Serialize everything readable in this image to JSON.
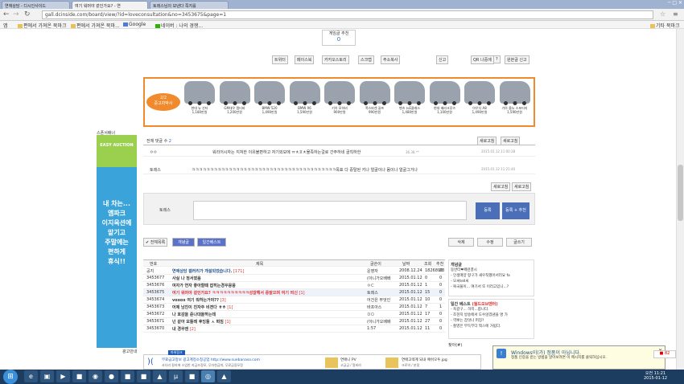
{
  "browser": {
    "tabs": [
      "연애상담 - 디시인사이드",
      "여기 워머야 겉인가요? - 연",
      "토레스님의 보낸다 쪽지를"
    ],
    "url": "gall.dcinside.com/board/view/?id=loveconsultation&no=3453675&page=1"
  },
  "bookmarks": [
    "앱",
    "편에서 가져온 북마크",
    "편에서 가져온 북마...",
    "Google",
    "네이버 : 나의 경쟁...",
    "기타 북마크"
  ],
  "vote": {
    "label": "게임글 추천",
    "count": "0"
  },
  "share": [
    "트위터",
    "페이스북",
    "카카오스토리",
    "스크랩",
    "주소복사"
  ],
  "report": {
    "btn1": "신고",
    "btn2": "QR 나중에",
    "qmark": "?",
    "report": "원본글 신고"
  },
  "ad": {
    "label": "2/2",
    "brand": "중고차박사",
    "cars": [
      {
        "name": "현대 뉴 산타",
        "price": "1,180만원"
      },
      {
        "name": "GM대우 캡티바",
        "price": "1,200만원"
      },
      {
        "name": "BMW 520",
        "price": "1,490만원"
      },
      {
        "name": "BMW X6",
        "price": "1,590만원"
      },
      {
        "name": "기아 모하비",
        "price": "900만원"
      },
      {
        "name": "폭스바겐 골프",
        "price": "990만원"
      },
      {
        "name": "벤츠 뉴E클래스",
        "price": "1,480만원"
      },
      {
        "name": "현대 베라크루즈",
        "price": "1,100만원"
      },
      {
        "name": "아우디 A8",
        "price": "1,490만원"
      },
      {
        "name": "기아 올뉴 스포티지",
        "price": "1,590만원"
      }
    ]
  },
  "comments": {
    "header": "전체 댓글 수",
    "count": "2",
    "controls": [
      "새로고침",
      "새로고침"
    ],
    "items": [
      {
        "name": "ㅇㅇ",
        "text": "워리어시자는 지쳐한 이유불편하고 자기외모에 ㅠㅊㅍㅊ물족하는걸로 간주하네 골칙하한",
        "ip": "36.38.**",
        "date": "2015.01.12 11:00:38"
      },
      {
        "name": "토레스",
        "text": "ㅋㅋㅋㅋㅋㅋㅋㅋㅋㅋㅋㅋㅋㅋㅋㅋㅋㅋㅋㅋㅋㅋㅋㅋㅋㅋㅋㅋㅋㅋㅋㅋㅋㅋㅋㅋㅋㅋㅋ목표 다 중탈된 키나 얼굴이나 몸이나 얼굴그거나",
        "ip": "",
        "date": "2015.01.12 11:21:40"
      }
    ],
    "name_label": "토레스",
    "submit": "등록",
    "submit2": "등록 + 추천"
  },
  "actions": {
    "all": "전체목록",
    "popular": "개념글",
    "best": "일간베스트",
    "delete": "삭제",
    "edit": "수정",
    "write": "글쓰기"
  },
  "list": {
    "headers": [
      "번호",
      "제목",
      "글쓴이",
      "날짜",
      "조회",
      "추천"
    ],
    "rows": [
      {
        "no": "공지",
        "title": "연애상담 갤러리가 개설되었습니다.",
        "cnt": "[171]",
        "writer": "운영자",
        "date": "2008.12.24",
        "views": "1826899",
        "rec": "23"
      },
      {
        "no": "3453677",
        "title": "사실 나 정서였음",
        "cnt": "",
        "writer": "(아니가오배배",
        "date": "2015.01.12",
        "views": "0",
        "rec": "0"
      },
      {
        "no": "3453676",
        "title": "여자가 연자 좋아할때 잡히는경우뭉뭉",
        "cnt": "",
        "writer": "ㅇㄷ",
        "date": "2015.01.12",
        "views": "1",
        "rec": "0"
      },
      {
        "no": "3453675",
        "title": "여기 워머야 겉인가요? ㅋㅋㅋㅋㅋㅋㅋㅋㅋㅋ성깔해서 중발으며 여기 피신",
        "cnt": "[1]",
        "writer": "토레스",
        "date": "2015.01.12",
        "views": "15",
        "rec": "0"
      },
      {
        "no": "3453674",
        "title": "voxox 여기 뭐하는거야??",
        "cnt": "[3]",
        "writer": "어건은 무엇인",
        "date": "2015.01.12",
        "views": "10",
        "rec": "0"
      },
      {
        "no": "3453673",
        "title": "어제 남친이 친자주 비젼다 ㅎㅎ",
        "cnt": "[1]",
        "writer": "바프아스",
        "date": "2015.01.12",
        "views": "7",
        "rec": "1"
      },
      {
        "no": "3453672",
        "title": "나 호감을 준나대올하는데",
        "cnt": "",
        "writer": "ㅁㅁ",
        "date": "2015.01.12",
        "views": "17",
        "rec": "0"
      },
      {
        "no": "3453671",
        "title": "넌 같아 모돌레 후잉돌 ㅅ 떠짐",
        "cnt": "[1]",
        "writer": "(아니가오배배",
        "date": "2015.01.12",
        "views": "27",
        "rec": "0"
      },
      {
        "no": "3453670",
        "title": "내 경우엔",
        "cnt": "[2]",
        "writer": "1:57",
        "date": "2015.01.12",
        "views": "11",
        "rec": "0"
      }
    ]
  },
  "right": {
    "title1": "개념글",
    "items1": [
      "동반터❤페련결시",
      "- 인생매양 항구가 새우칙했어서러요 fa",
      "- 모씨tell씨",
      "- 복국물이... 여기서 또 이러고있니...?"
    ],
    "title2": "일간 베스트",
    "title2b": "(월드오브멘터)",
    "items2": [
      "- 욕갈구... 하지...합니다.",
      "- 조현지 방송에서 도수않겠냄을 명 가",
      "- 역뽀는 잡엇나 퍼징?",
      "- 촬영은 부득부다 짝스에 거립다."
    ],
    "more": "찾아(#)"
  },
  "left": {
    "label": "스폰서배너",
    "lines": [
      "내 차는...",
      "엠파크",
      "이지옥션에",
      "맡기고",
      "주말에는",
      "편하게",
      "휴식!!"
    ],
    "brand": "EASY AUCTION",
    "bottom": "광고안내"
  },
  "footer_ads": [
    {
      "tag": "파워링크",
      "title": "무료금고정보 광고계정소정공업 http://www.suebanaso.com",
      "desc": "사다리 칼라에 스업한 지금조정모, 무자한금마, 무료금융모정"
    },
    {
      "title": "연애니 PV",
      "desc": "고급금 / 얼비라"
    },
    {
      "title": "연애고렉계 되내 예쉬오투.jpg",
      "desc": "크로의 / 분맞"
    }
  ],
  "popup": {
    "title": "Windows이(가) 정품이 아닙니다.",
    "desc": "정품 인증을 받는 방법을 알아보려면 이 메시지를 클릭하십시오."
  },
  "taskbar": {
    "time": "오전 11:21",
    "date": "2015-01-12",
    "badge": "82"
  }
}
